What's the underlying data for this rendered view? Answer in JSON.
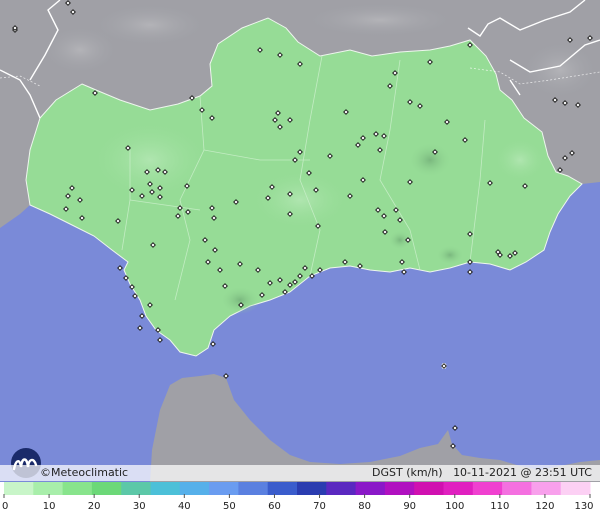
{
  "credit": "©Meteoclimatic",
  "caption": {
    "variable": "DGST (km/h)",
    "timestamp": "10-11-2021 @ 23:51 UTC"
  },
  "legend": {
    "ticks": [
      "0",
      "10",
      "20",
      "30",
      "40",
      "50",
      "60",
      "70",
      "80",
      "90",
      "100",
      "110",
      "120",
      "130"
    ],
    "colors": [
      "#c8f5c8",
      "#a8eeaa",
      "#88e48c",
      "#6cd878",
      "#5cc8a8",
      "#4cc0d8",
      "#56b0ea",
      "#6a9cf0",
      "#5a80e0",
      "#3a5ccc",
      "#2a3cb0",
      "#5a28c0",
      "#8a18c8",
      "#b010c0",
      "#d010b0",
      "#e020c0",
      "#f040d0",
      "#f470e0",
      "#f8a0ec",
      "#fcd0f4"
    ]
  },
  "colors": {
    "sea": "#7a8ad8",
    "land": "#96dc96",
    "outside_land": "#a0a0a6"
  },
  "stations": [
    [
      15,
      30
    ],
    [
      68,
      3
    ],
    [
      73,
      12
    ],
    [
      15,
      28
    ],
    [
      95,
      93
    ],
    [
      192,
      98
    ],
    [
      202,
      110
    ],
    [
      260,
      50
    ],
    [
      280,
      55
    ],
    [
      300,
      64
    ],
    [
      395,
      73
    ],
    [
      430,
      62
    ],
    [
      470,
      45
    ],
    [
      555,
      100
    ],
    [
      565,
      103
    ],
    [
      578,
      105
    ],
    [
      570,
      40
    ],
    [
      590,
      38
    ],
    [
      212,
      118
    ],
    [
      275,
      120
    ],
    [
      280,
      127
    ],
    [
      290,
      120
    ],
    [
      278,
      113
    ],
    [
      346,
      112
    ],
    [
      390,
      86
    ],
    [
      410,
      102
    ],
    [
      420,
      106
    ],
    [
      447,
      122
    ],
    [
      363,
      138
    ],
    [
      376,
      134
    ],
    [
      384,
      136
    ],
    [
      358,
      145
    ],
    [
      380,
      150
    ],
    [
      300,
      152
    ],
    [
      295,
      160
    ],
    [
      309,
      173
    ],
    [
      316,
      190
    ],
    [
      290,
      194
    ],
    [
      330,
      156
    ],
    [
      435,
      152
    ],
    [
      465,
      140
    ],
    [
      410,
      182
    ],
    [
      490,
      183
    ],
    [
      525,
      186
    ],
    [
      560,
      170
    ],
    [
      565,
      158
    ],
    [
      572,
      153
    ],
    [
      128,
      148
    ],
    [
      147,
      172
    ],
    [
      158,
      170
    ],
    [
      165,
      172
    ],
    [
      150,
      184
    ],
    [
      160,
      188
    ],
    [
      132,
      190
    ],
    [
      142,
      196
    ],
    [
      152,
      192
    ],
    [
      160,
      197
    ],
    [
      187,
      186
    ],
    [
      272,
      187
    ],
    [
      268,
      198
    ],
    [
      236,
      202
    ],
    [
      212,
      208
    ],
    [
      188,
      212
    ],
    [
      180,
      208
    ],
    [
      178,
      216
    ],
    [
      214,
      218
    ],
    [
      290,
      214
    ],
    [
      318,
      226
    ],
    [
      350,
      196
    ],
    [
      363,
      180
    ],
    [
      378,
      210
    ],
    [
      384,
      216
    ],
    [
      396,
      210
    ],
    [
      400,
      220
    ],
    [
      385,
      232
    ],
    [
      408,
      240
    ],
    [
      470,
      234
    ],
    [
      498,
      252
    ],
    [
      72,
      188
    ],
    [
      68,
      196
    ],
    [
      80,
      200
    ],
    [
      66,
      209
    ],
    [
      82,
      218
    ],
    [
      118,
      221
    ],
    [
      153,
      245
    ],
    [
      205,
      240
    ],
    [
      215,
      250
    ],
    [
      208,
      262
    ],
    [
      220,
      270
    ],
    [
      240,
      264
    ],
    [
      258,
      270
    ],
    [
      290,
      285
    ],
    [
      285,
      292
    ],
    [
      305,
      268
    ],
    [
      312,
      276
    ],
    [
      320,
      270
    ],
    [
      280,
      280
    ],
    [
      270,
      283
    ],
    [
      295,
      282
    ],
    [
      300,
      276
    ],
    [
      262,
      295
    ],
    [
      241,
      305
    ],
    [
      225,
      286
    ],
    [
      345,
      262
    ],
    [
      360,
      266
    ],
    [
      402,
      262
    ],
    [
      404,
      272
    ],
    [
      470,
      262
    ],
    [
      470,
      272
    ],
    [
      500,
      255
    ],
    [
      510,
      256
    ],
    [
      515,
      253
    ],
    [
      120,
      268
    ],
    [
      126,
      278
    ],
    [
      132,
      287
    ],
    [
      135,
      296
    ],
    [
      150,
      305
    ],
    [
      142,
      316
    ],
    [
      140,
      328
    ],
    [
      158,
      330
    ],
    [
      160,
      340
    ],
    [
      213,
      344
    ],
    [
      226,
      376
    ],
    [
      444,
      366
    ],
    [
      455,
      428
    ],
    [
      453,
      446
    ]
  ]
}
